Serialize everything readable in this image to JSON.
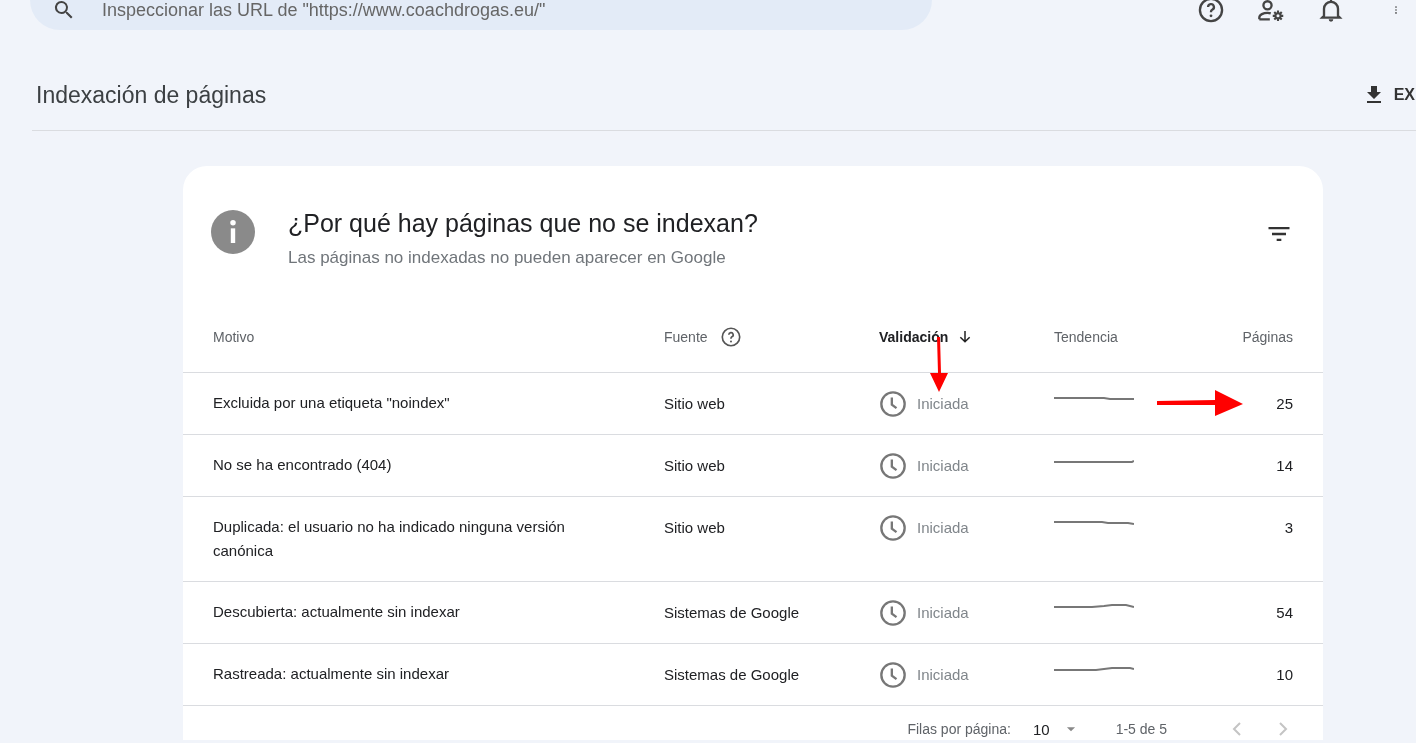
{
  "search": {
    "placeholder": "Inspeccionar las URL de \"https://www.coachdrogas.eu/\""
  },
  "page_title": "Indexación de páginas",
  "export_button": {
    "label": "EX"
  },
  "card": {
    "title": "¿Por qué hay páginas que no se indexan?",
    "subtitle": "Las páginas no indexadas no pueden aparecer en Google"
  },
  "table": {
    "columns": [
      {
        "label": "Motivo",
        "sorted": false,
        "help": false
      },
      {
        "label": "Fuente",
        "sorted": false,
        "help": true
      },
      {
        "label": "Validación",
        "sorted": true,
        "help": false
      },
      {
        "label": "Tendencia",
        "sorted": false,
        "help": false
      },
      {
        "label": "Páginas",
        "sorted": false,
        "help": false
      }
    ],
    "rows": [
      {
        "motivo": "Excluida por una etiqueta \"noindex\"",
        "fuente": "Sitio web",
        "validacion": "Iniciada",
        "paginas": "25",
        "marked": true
      },
      {
        "motivo": "No se ha encontrado (404)",
        "fuente": "Sitio web",
        "validacion": "Iniciada",
        "paginas": "14",
        "marked": false
      },
      {
        "motivo": "Duplicada: el usuario no ha indicado ninguna versión canónica",
        "fuente": "Sitio web",
        "validacion": "Iniciada",
        "paginas": "3",
        "marked": false
      },
      {
        "motivo": "Descubierta: actualmente sin indexar",
        "fuente": "Sistemas de Google",
        "validacion": "Iniciada",
        "paginas": "54",
        "marked": false
      },
      {
        "motivo": "Rastreada: actualmente sin indexar",
        "fuente": "Sistemas de Google",
        "validacion": "Iniciada",
        "paginas": "10",
        "marked": false
      }
    ]
  },
  "pagination": {
    "rows_label": "Filas por página:",
    "rows_value": "10",
    "range": "1-5 de 5",
    "prev_disabled": true,
    "next_disabled": true
  }
}
